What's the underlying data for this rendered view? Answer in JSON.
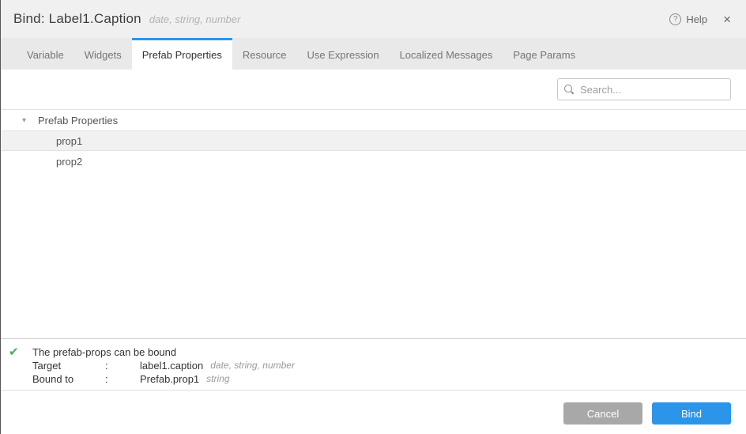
{
  "dialog": {
    "title": "Bind: Label1.Caption",
    "title_hint": "date, string, number",
    "help_label": "Help",
    "help_icon_glyph": "?",
    "close_icon_glyph": "×"
  },
  "tabs": [
    {
      "label": "Variable",
      "active": false
    },
    {
      "label": "Widgets",
      "active": false
    },
    {
      "label": "Prefab Properties",
      "active": true
    },
    {
      "label": "Resource",
      "active": false
    },
    {
      "label": "Use Expression",
      "active": false
    },
    {
      "label": "Localized Messages",
      "active": false
    },
    {
      "label": "Page Params",
      "active": false
    }
  ],
  "search": {
    "placeholder": "Search...",
    "icon": "magnifier-icon",
    "value": ""
  },
  "tree": {
    "group": {
      "label": "Prefab Properties",
      "expanded": true,
      "caret_glyph": "▾"
    },
    "items": [
      {
        "label": "prop1",
        "selected": true
      },
      {
        "label": "prop2",
        "selected": false
      }
    ]
  },
  "info": {
    "check_icon_glyph": "✔",
    "message": "The prefab-props can be bound",
    "rows": [
      {
        "label": "Target",
        "colon": ":",
        "value": "label1.caption",
        "hint": "date, string, number"
      },
      {
        "label": "Bound to",
        "colon": ":",
        "value": "Prefab.prop1",
        "hint": "string"
      }
    ]
  },
  "footer": {
    "cancel_label": "Cancel",
    "bind_label": "Bind"
  },
  "colors": {
    "accent_blue": "#2b95e9",
    "success_green": "#47b14c",
    "cancel_gray": "#a8a8a8",
    "header_bg": "#f0f0f0",
    "tabbar_bg": "#e9e9e9",
    "selected_row_bg": "#f1f1f1"
  }
}
